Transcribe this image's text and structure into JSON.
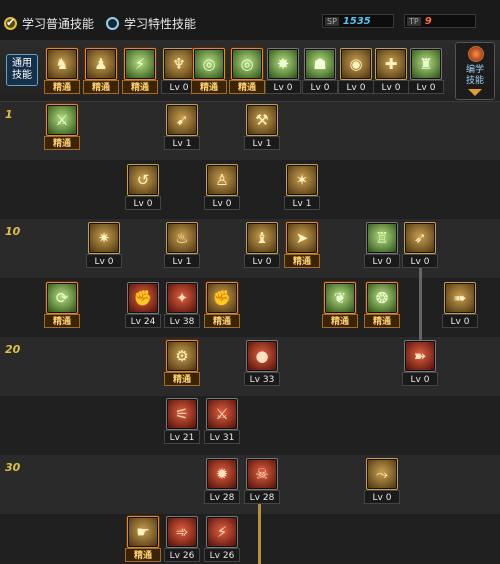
{
  "header": {
    "learn_normal": "学习普通技能",
    "learn_special": "学习特性技能",
    "sp_tag": "SP",
    "sp_value": "1535",
    "tp_tag": "TP",
    "tp_value": "9",
    "sp_color": "#52c8f0",
    "tp_color": "#ff7040"
  },
  "general_skill_label": "通用\n技能",
  "bookmark_label": "编学\n技能",
  "level_labels": [
    "1",
    "10",
    "20",
    "30"
  ],
  "bar_skills": [
    {
      "icon": "rider-icon",
      "caption": "精通",
      "mastered": true
    },
    {
      "icon": "runner-icon",
      "caption": "精通",
      "mastered": true
    },
    {
      "icon": "kick-icon",
      "caption": "精通",
      "mastered": true
    },
    {
      "icon": "wings-icon",
      "caption": "Lv 0",
      "mastered": false
    },
    {
      "icon": "target-icon",
      "caption": "精通",
      "mastered": true
    },
    {
      "icon": "target-icon",
      "caption": "精通",
      "mastered": true
    },
    {
      "icon": "burst-icon",
      "caption": "Lv 0",
      "mastered": false
    },
    {
      "icon": "figure-icon",
      "caption": "Lv 0",
      "mastered": false
    },
    {
      "icon": "eye-icon",
      "caption": "Lv 0",
      "mastered": false
    },
    {
      "icon": "flex-icon",
      "caption": "Lv 0",
      "mastered": false
    },
    {
      "icon": "green-figure-icon",
      "caption": "Lv 0",
      "mastered": false
    }
  ],
  "tree_skills": [
    {
      "icon": "slash-icon",
      "caption": "精通",
      "mastered": true
    },
    {
      "icon": "strike-icon",
      "caption": "Lv 1",
      "mastered": false
    },
    {
      "icon": "axe-icon",
      "caption": "Lv 1",
      "mastered": false
    },
    {
      "icon": "spin-icon",
      "caption": "Lv 0",
      "mastered": false
    },
    {
      "icon": "stance-icon",
      "caption": "Lv 0",
      "mastered": false
    },
    {
      "icon": "spark-icon",
      "caption": "Lv 1",
      "mastered": false
    },
    {
      "icon": "shatter-icon",
      "caption": "Lv 0",
      "mastered": false
    },
    {
      "icon": "flame-icon",
      "caption": "Lv 1",
      "mastered": false
    },
    {
      "icon": "crouch-icon",
      "caption": "Lv 0",
      "mastered": false
    },
    {
      "icon": "sprint-icon",
      "caption": "精通",
      "mastered": true
    },
    {
      "icon": "armor-icon",
      "caption": "Lv 0",
      "mastered": false
    },
    {
      "icon": "throw-icon",
      "caption": "Lv 0",
      "mastered": false
    },
    {
      "icon": "cycle-icon",
      "caption": "精通",
      "mastered": true
    },
    {
      "icon": "fire-fist-icon",
      "caption": "Lv 24",
      "mastered": false
    },
    {
      "icon": "fire-kick-icon",
      "caption": "Lv 38",
      "mastered": false
    },
    {
      "icon": "fist-icon",
      "caption": "精通",
      "mastered": true
    },
    {
      "icon": "leaf-icon",
      "caption": "精通",
      "mastered": true
    },
    {
      "icon": "drop-icon",
      "caption": "精通",
      "mastered": true
    },
    {
      "icon": "dash-icon",
      "caption": "Lv 0",
      "mastered": false
    },
    {
      "icon": "gear-icon",
      "caption": "精通",
      "mastered": true
    },
    {
      "icon": "bomb-icon",
      "caption": "Lv 33",
      "mastered": false
    },
    {
      "icon": "charge-icon",
      "caption": "Lv 0",
      "mastered": false
    },
    {
      "icon": "claw-icon",
      "caption": "Lv 21",
      "mastered": false
    },
    {
      "icon": "blade-icon",
      "caption": "Lv 31",
      "mastered": false
    },
    {
      "icon": "smash-icon",
      "caption": "Lv 28",
      "mastered": false
    },
    {
      "icon": "berserk-icon",
      "caption": "Lv 28",
      "mastered": false
    },
    {
      "icon": "slide-icon",
      "caption": "Lv 0",
      "mastered": false
    },
    {
      "icon": "grab-icon",
      "caption": "精通",
      "mastered": true
    },
    {
      "icon": "red-dash-icon",
      "caption": "Lv 26",
      "mastered": false
    },
    {
      "icon": "rend-icon",
      "caption": "Lv 26",
      "mastered": false
    }
  ]
}
